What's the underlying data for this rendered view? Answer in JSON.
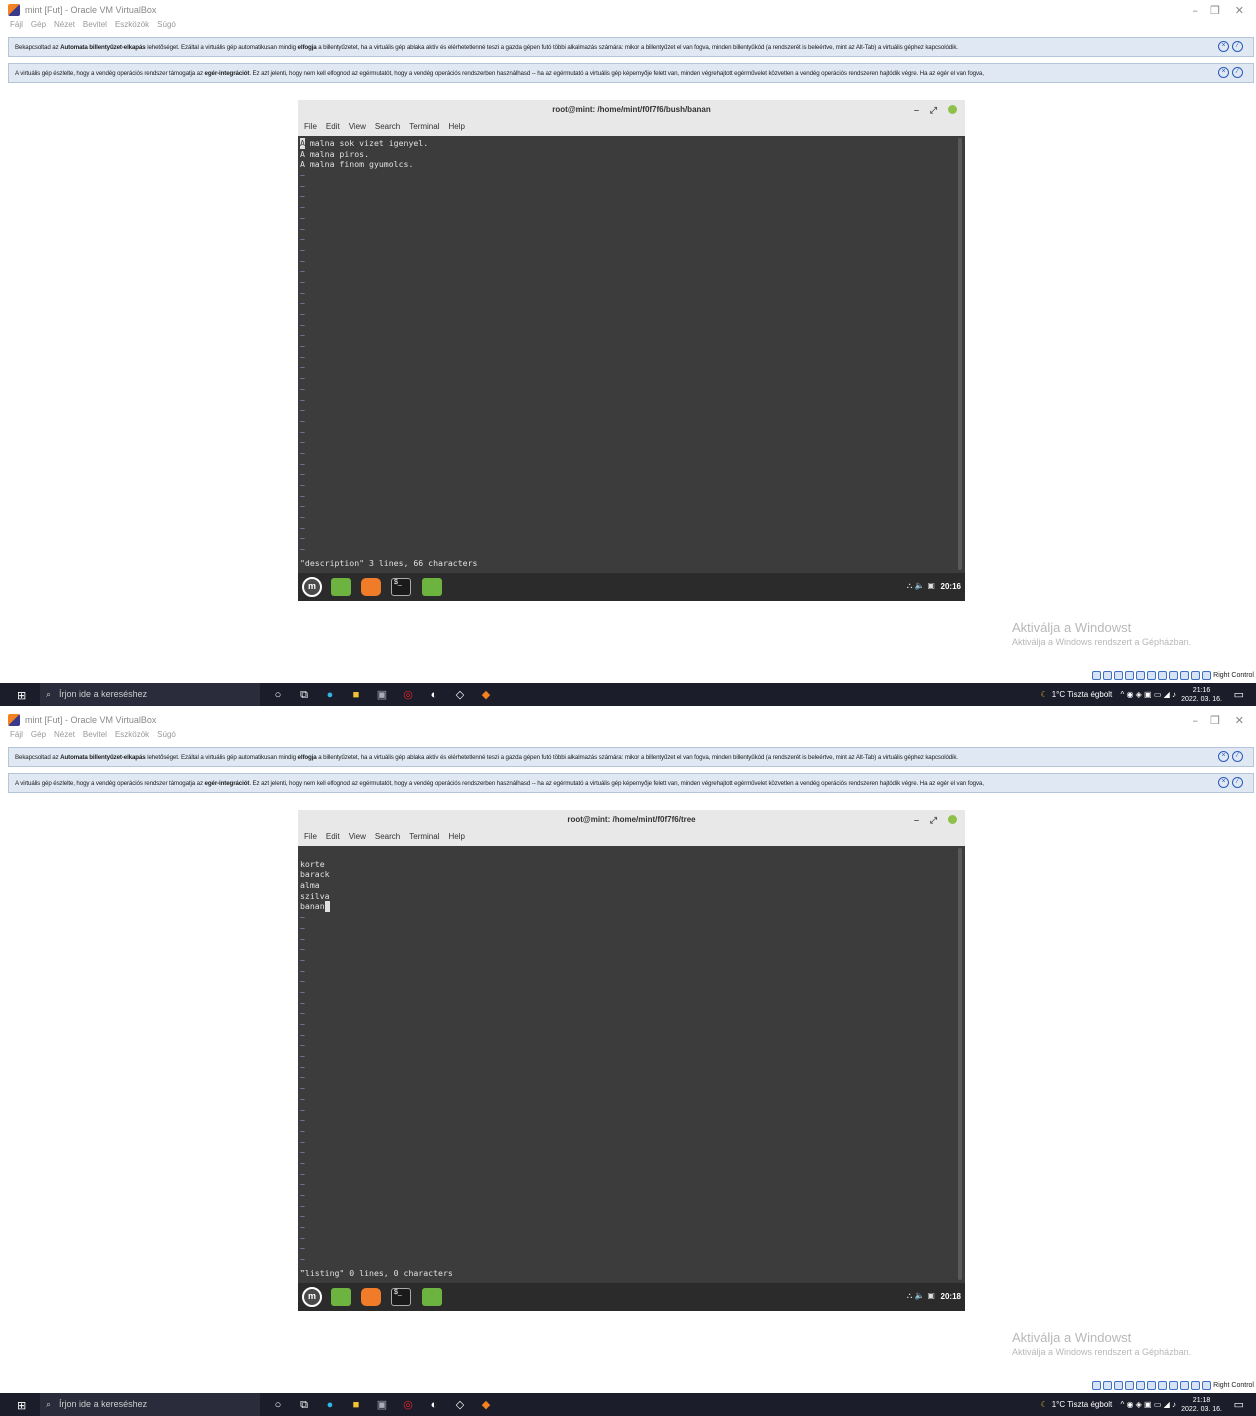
{
  "screenshots": [
    {
      "vbox": {
        "title": "mint [Fut] - Oracle VM VirtualBox",
        "menu": [
          "Fájl",
          "Gép",
          "Nézet",
          "Bevitel",
          "Eszközök",
          "Súgó"
        ],
        "banner1": {
          "pre": "Bekapcsoltad az ",
          "b1": "Automata billentyűzet-elkapás",
          "mid1": " lehetőséget. Ezáltal a virtuális gép automatikusan mindig ",
          "b2": "elfogja",
          "post": " a billentyűzetet, ha a virtuális gép ablaka aktív és elérhetetlenné teszi a gazda gépen futó többi alkalmazás számára: mikor a billentyűzet el van fogva, minden billentyűkód (a rendszerét is beleértve, mint az Alt-Tab) a virtuális géphez kapcsolódik."
        },
        "banner2": {
          "pre": "A virtuális gép észlelte, hogy a vendég operációs rendszer támogatja az ",
          "b1": "egér-integrációt",
          "post": ". Ez azt jelenti, hogy nem kell elfognod az egérmutatót, hogy a vendég operációs rendszerben használhasd -- ha az egérmutató a virtuális gép képernyője felett van, minden végrehajtott egérművelet közvetlen a vendég operációs rendszeren hajtódik végre. Ha az egér el van fogva,"
        },
        "status_label": "Right Control"
      },
      "terminal": {
        "title": "root@mint: /home/mint/f0f7f6/bush/banan",
        "menu": [
          "File",
          "Edit",
          "View",
          "Search",
          "Terminal",
          "Help"
        ],
        "lines": [
          "A malna sok vizet igenyel.",
          "A malna piros.",
          "A malna finom gyumolcs."
        ],
        "tilde_count": 36,
        "status": "\"description\" 3 lines, 66 characters",
        "clock": "20:16"
      },
      "watermark": {
        "title": "Aktiválja a Windowst",
        "sub": "Aktiválja a Windows rendszert a Gépházban."
      },
      "taskbar": {
        "search_placeholder": "Írjon ide a kereséshez",
        "weather": "1°C  Tiszta égbolt",
        "time": "21:16",
        "date": "2022. 03. 16."
      }
    },
    {
      "vbox": {
        "title": "mint [Fut] - Oracle VM VirtualBox",
        "menu": [
          "Fájl",
          "Gép",
          "Nézet",
          "Bevitel",
          "Eszközök",
          "Súgó"
        ],
        "banner1": {
          "pre": "Bekapcsoltad az ",
          "b1": "Automata billentyűzet-elkapás",
          "mid1": " lehetőséget. Ezáltal a virtuális gép automatikusan mindig ",
          "b2": "elfogja",
          "post": " a billentyűzetet, ha a virtuális gép ablaka aktív és elérhetetlenné teszi a gazda gépen futó többi alkalmazás számára: mikor a billentyűzet el van fogva, minden billentyűkód (a rendszerét is beleértve, mint az Alt-Tab) a virtuális géphez kapcsolódik."
        },
        "banner2": {
          "pre": "A virtuális gép észlelte, hogy a vendég operációs rendszer támogatja az ",
          "b1": "egér-integrációt",
          "post": ". Ez azt jelenti, hogy nem kell elfognod az egérmutatót, hogy a vendég operációs rendszerben használhasd -- ha az egérmutató a virtuális gép képernyője felett van, minden végrehajtott egérművelet közvetlen a vendég operációs rendszeren hajtódik végre. Ha az egér el van fogva,"
        },
        "status_label": "Right Control"
      },
      "terminal": {
        "title": "root@mint: /home/mint/f0f7f6/tree",
        "menu": [
          "File",
          "Edit",
          "View",
          "Search",
          "Terminal",
          "Help"
        ],
        "lines": [
          "",
          "korte",
          "barack",
          "alma",
          "szilva",
          "banan"
        ],
        "tilde_count": 34,
        "status": "\"listing\" 0 lines, 0 characters",
        "clock": "20:18"
      },
      "watermark": {
        "title": "Aktiválja a Windowst",
        "sub": "Aktiválja a Windows rendszert a Gépházban."
      },
      "taskbar": {
        "search_placeholder": "Írjon ide a kereséshez",
        "weather": "1°C  Tiszta égbolt",
        "time": "21:18",
        "date": "2022. 03. 16."
      }
    }
  ]
}
